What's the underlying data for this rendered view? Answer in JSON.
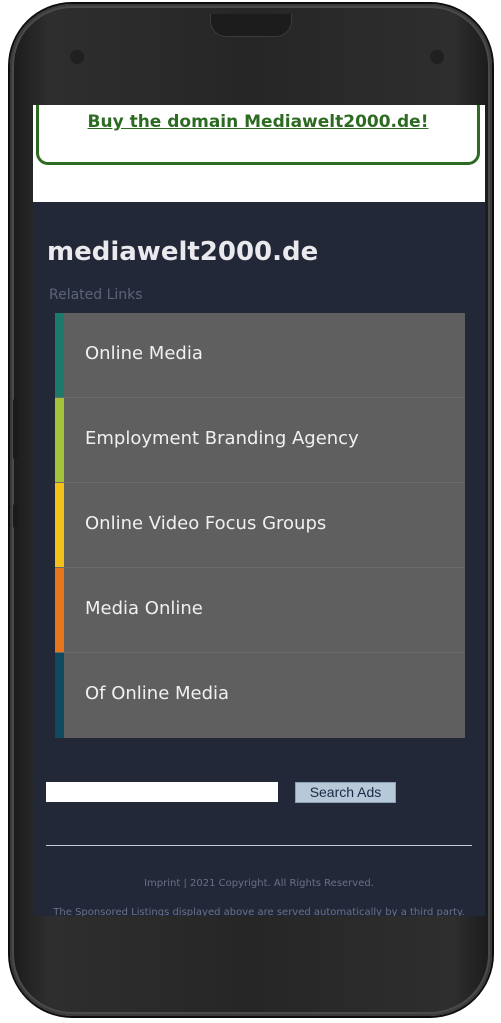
{
  "banner": {
    "domain_link": "Buy the domain Mediawelt2000.de!"
  },
  "site": {
    "title": "mediawelt2000.de",
    "related_label": "Related Links"
  },
  "links": [
    {
      "label": "Online Media",
      "color": "#1d7a6a"
    },
    {
      "label": "Employment Branding Agency",
      "color": "#a6c23a"
    },
    {
      "label": "Online Video Focus Groups",
      "color": "#f2c21a"
    },
    {
      "label": "Media Online",
      "color": "#e8751a"
    },
    {
      "label": "Of Online Media",
      "color": "#0f4a5e"
    }
  ],
  "search": {
    "value": "",
    "button_label": "Search Ads"
  },
  "footer": {
    "line1": "Imprint | 2021 Copyright. All Rights Reserved.",
    "line2": "The Sponsored Listings displayed above are served automatically by a third party."
  },
  "colors": {
    "background": "#232838",
    "link_bg": "#5f5f5f",
    "domain_green": "#2e6b22"
  }
}
